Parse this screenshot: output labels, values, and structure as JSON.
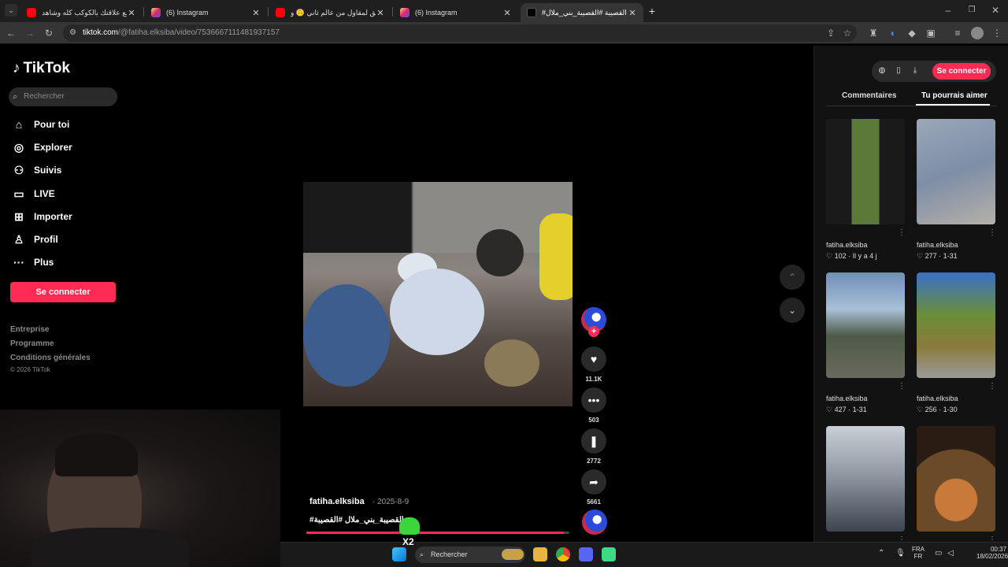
{
  "browser": {
    "tabs": [
      {
        "label": "إقطع علاقتك بالكوكب كله وشاهد",
        "icon": "youtube-icon"
      },
      {
        "label": "(6) Instagram",
        "icon": "instagram-icon"
      },
      {
        "label": "شقق لمقاول من عالم ثاني 🙃 و",
        "icon": "youtube-icon"
      },
      {
        "label": "(6) Instagram",
        "icon": "instagram-icon"
      },
      {
        "label": "#القصيبة #القصيبة_بني_ملال | ...",
        "icon": "tiktok-icon",
        "active": true
      }
    ],
    "new_tab": "+",
    "url_host": "tiktok.com",
    "url_path": "/@fatiha.elksiba/video/7536667111481937157"
  },
  "sidebar": {
    "brand": "TikTok",
    "search_placeholder": "Rechercher",
    "nav": [
      {
        "label": "Pour toi",
        "icon": "home-icon"
      },
      {
        "label": "Explorer",
        "icon": "compass-icon"
      },
      {
        "label": "Suivis",
        "icon": "following-icon"
      },
      {
        "label": "LIVE",
        "icon": "live-icon"
      },
      {
        "label": "Importer",
        "icon": "upload-icon"
      },
      {
        "label": "Profil",
        "icon": "profile-icon"
      },
      {
        "label": "Plus",
        "icon": "more-icon"
      }
    ],
    "login": "Se connecter",
    "footer": [
      "Entreprise",
      "Programme",
      "Conditions générales"
    ],
    "copyright": "© 2026 TikTok"
  },
  "video": {
    "author": "fatiha.elksiba",
    "date": "· 2025-8-9",
    "caption": "#القصيبة_بني_ملال #القصيبة",
    "progress": 0.98
  },
  "actions": {
    "likes": "11.1K",
    "comments": "503",
    "saves": "2772",
    "shares": "5661"
  },
  "right_panel": {
    "login": "Se connecter",
    "tabs": [
      "Commentaires",
      "Tu pourrais aimer"
    ],
    "active_tab": "Tu pourrais aimer",
    "suggestions": [
      {
        "author": "fatiha.elksiba",
        "likes": "102",
        "time": "Il y a 4 j"
      },
      {
        "author": "fatiha.elksiba",
        "likes": "277",
        "time": "1-31"
      },
      {
        "author": "fatiha.elksiba",
        "likes": "427",
        "time": "1-31"
      },
      {
        "author": "fatiha.elksiba",
        "likes": "256",
        "time": "1-30"
      },
      {
        "author": "",
        "likes": "",
        "time": ""
      },
      {
        "author": "",
        "likes": "",
        "time": ""
      }
    ]
  },
  "taskbar": {
    "search": "Rechercher",
    "lang_top": "FRA",
    "lang_bottom": "FR",
    "time": "00:37",
    "date": "18/02/2026"
  },
  "overlay": {
    "mascot_label": "X2"
  },
  "colors": {
    "accent": "#fe2c55",
    "background": "#000000",
    "panel": "#121212"
  }
}
